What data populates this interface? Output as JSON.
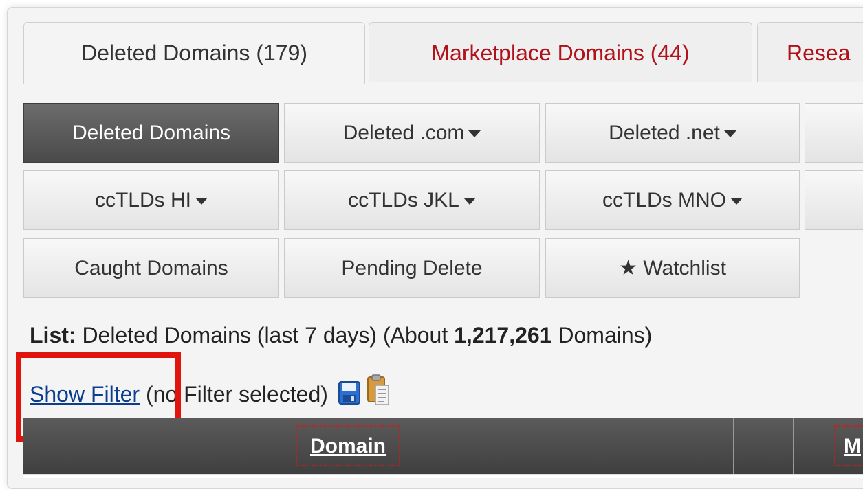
{
  "tabs": [
    {
      "label": "Deleted Domains (179)",
      "active": true
    },
    {
      "label": "Marketplace Domains (44)",
      "active": false
    },
    {
      "label": "Resea",
      "active": false
    }
  ],
  "buttons": {
    "row1": [
      "Deleted Domains",
      "Deleted .com",
      "Deleted .net"
    ],
    "row2": [
      "ccTLDs HI",
      "ccTLDs JKL",
      "ccTLDs MNO"
    ],
    "row3": [
      "Caught Domains",
      "Pending Delete",
      "Watchlist"
    ]
  },
  "list_info": {
    "prefix": "List:",
    "text": " Deleted Domains (last 7 days) (About ",
    "count": "1,217,261",
    "suffix": " Domains)"
  },
  "filter": {
    "link": "Show Filter",
    "status": "(no Filter selected)"
  },
  "table": {
    "columns": [
      "Domain",
      "M"
    ]
  },
  "colors": {
    "accent_red": "#b0121b",
    "highlight": "#e0140c",
    "link": "#0b3d91"
  },
  "icons": [
    "save-icon",
    "clipboard-icon",
    "star-icon",
    "chevron-down-icon"
  ]
}
